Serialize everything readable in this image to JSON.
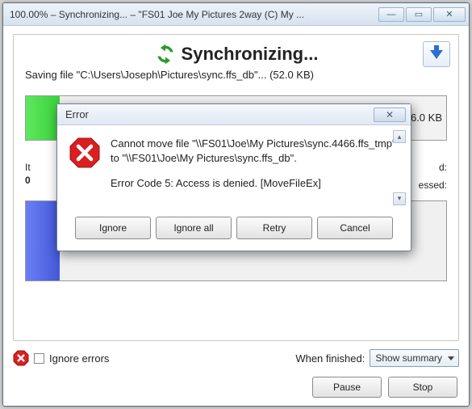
{
  "window": {
    "title": "100.00% – Synchronizing... – \"FS01 Joe My Pictures 2way (C) My ..."
  },
  "sync": {
    "title": "Synchronizing...",
    "status": "Saving file \"C:\\Users\\Joseph\\Pictures\\sync.ffs_db\"... (52.0 KB)",
    "side_size": "6.0 KB",
    "items_label": "It",
    "items_value": "0",
    "remaining_label": "d:",
    "processed_label": "essed:"
  },
  "footer": {
    "ignore_errors": "Ignore errors",
    "when_finished_label": "When finished:",
    "when_finished_value": "Show summary",
    "pause": "Pause",
    "stop": "Stop"
  },
  "dialog": {
    "title": "Error",
    "msg1": "Cannot move file \"\\\\FS01\\Joe\\My Pictures\\sync.4466.ffs_tmp\" to \"\\\\FS01\\Joe\\My Pictures\\sync.ffs_db\".",
    "msg2": "Error Code 5: Access is denied. [MoveFileEx]",
    "ignore": "Ignore",
    "ignore_all": "Ignore all",
    "retry": "Retry",
    "cancel": "Cancel"
  }
}
